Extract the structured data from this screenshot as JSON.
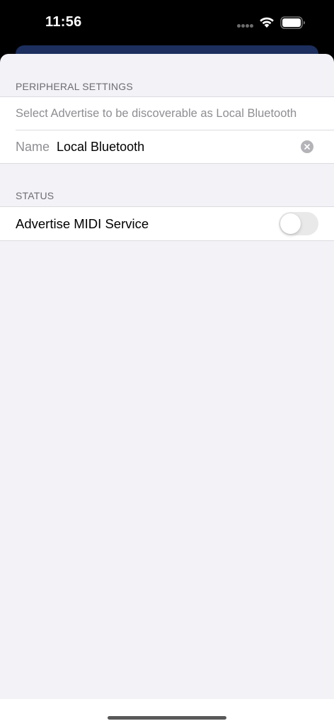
{
  "status_bar": {
    "time": "11:56",
    "icons": [
      "cellular-dots-icon",
      "wifi-icon",
      "battery-icon"
    ]
  },
  "peripheral_settings": {
    "header": "PERIPHERAL SETTINGS",
    "hint": "Select Advertise to be discoverable as Local Bluetooth",
    "name_label": "Name",
    "name_value": "Local Bluetooth",
    "clear_icon": "clear-circle-icon"
  },
  "status": {
    "header": "STATUS",
    "advertise_label": "Advertise MIDI Service",
    "advertise_on": false
  },
  "colors": {
    "sheet_background": "#f2f2f7",
    "under_card": "#1c2f5e",
    "toggle_off": "#e9e9ea"
  }
}
